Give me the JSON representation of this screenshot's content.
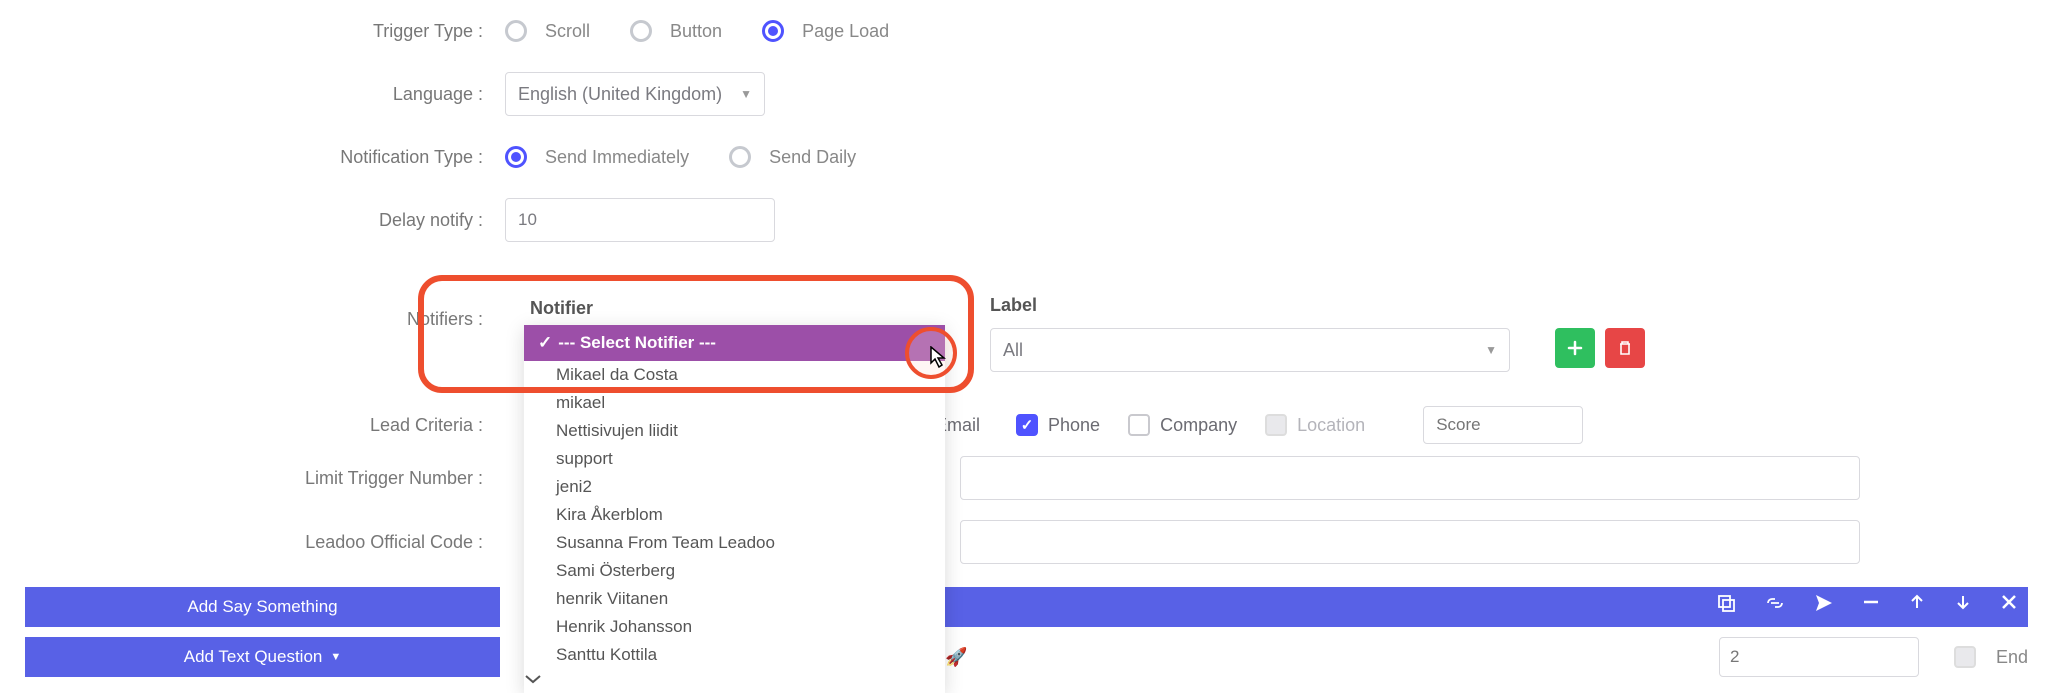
{
  "labels": {
    "triggerType": "Trigger Type :",
    "language": "Language :",
    "notificationType": "Notification Type :",
    "delayNotify": "Delay notify :",
    "notifiers": "Notifiers :",
    "leadCriteria": "Lead Criteria :",
    "limitTriggerNumber": "Limit Trigger Number :",
    "leadooCode": "Leadoo Official Code :"
  },
  "triggerOptions": {
    "scroll": "Scroll",
    "button": "Button",
    "pageLoad": "Page Load"
  },
  "triggerSelected": "pageLoad",
  "language": "English (United Kingdom)",
  "notificationOptions": {
    "immediate": "Send Immediately",
    "daily": "Send Daily"
  },
  "notificationSelected": "immediate",
  "delayValue": "10",
  "notifier": {
    "heading": "Notifier",
    "selected": "--- Select Notifier ---",
    "options": [
      "Mikael da Costa",
      "mikael",
      "Nettisivujen liidit",
      "support",
      "jeni2",
      "Kira Åkerblom",
      "Susanna From Team Leadoo",
      "Sami Österberg",
      "henrik Viitanen",
      "Henrik Johansson",
      "Santtu Kottila"
    ]
  },
  "labelField": {
    "heading": "Label",
    "value": "All"
  },
  "criteria": {
    "email": "Email",
    "phone": "Phone",
    "company": "Company",
    "location": "Location",
    "scorePlaceholder": "Score"
  },
  "criteriaChecked": {
    "phone": true
  },
  "buttons": {
    "addSay": "Add Say Something",
    "addText": "Add Text Question"
  },
  "textPreview": "of! 🚀",
  "footerNumber": "2",
  "endLabel": "End"
}
